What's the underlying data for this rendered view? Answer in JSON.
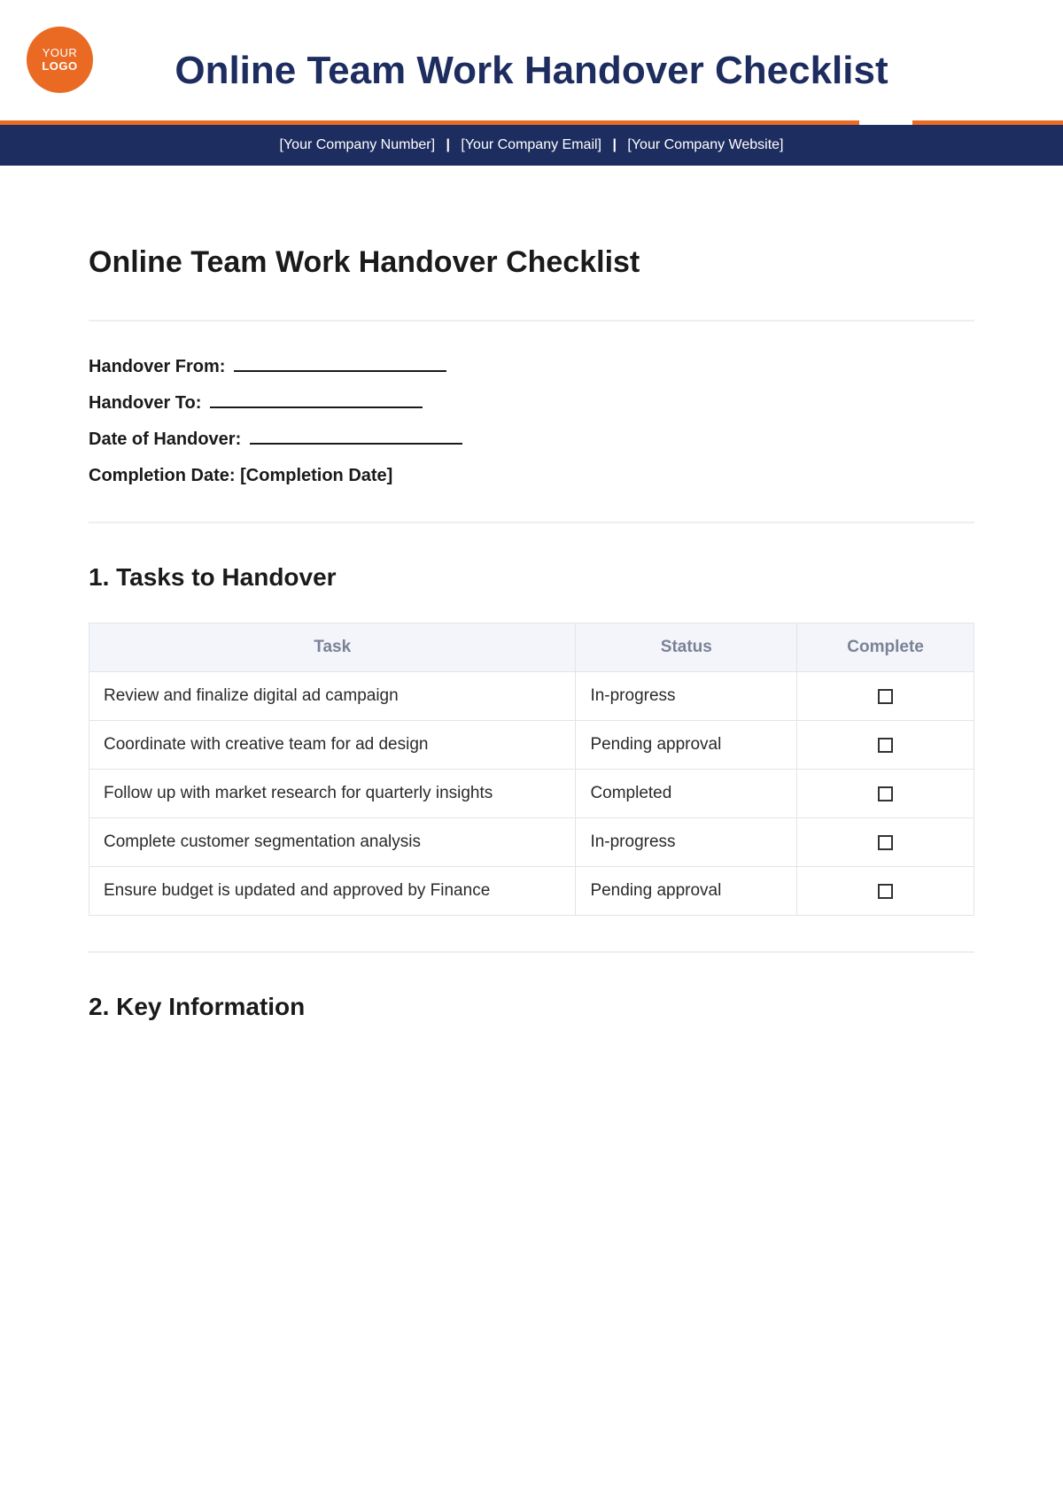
{
  "logo": {
    "line1": "YOUR",
    "line2": "LOGO"
  },
  "header": {
    "title": "Online Team Work Handover Checklist"
  },
  "company_bar": {
    "number": "[Your Company Number]",
    "email": "[Your Company Email]",
    "website": "[Your Company Website]"
  },
  "doc": {
    "title": "Online Team Work Handover Checklist"
  },
  "fields": {
    "handover_from_label": "Handover From:",
    "handover_to_label": "Handover To:",
    "date_of_handover_label": "Date of Handover:",
    "completion_date_label": "Completion Date:",
    "completion_date_value": "[Completion Date]"
  },
  "sections": {
    "tasks_title": "1. Tasks to Handover",
    "key_info_title": "2. Key Information"
  },
  "tasks_table": {
    "headers": {
      "task": "Task",
      "status": "Status",
      "complete": "Complete"
    },
    "rows": [
      {
        "task": "Review and finalize digital ad campaign",
        "status": "In-progress"
      },
      {
        "task": "Coordinate with creative team for ad design",
        "status": "Pending approval"
      },
      {
        "task": "Follow up with market research for quarterly insights",
        "status": "Completed"
      },
      {
        "task": "Complete customer segmentation analysis",
        "status": "In-progress"
      },
      {
        "task": "Ensure budget is updated and approved by Finance",
        "status": "Pending approval"
      }
    ]
  }
}
